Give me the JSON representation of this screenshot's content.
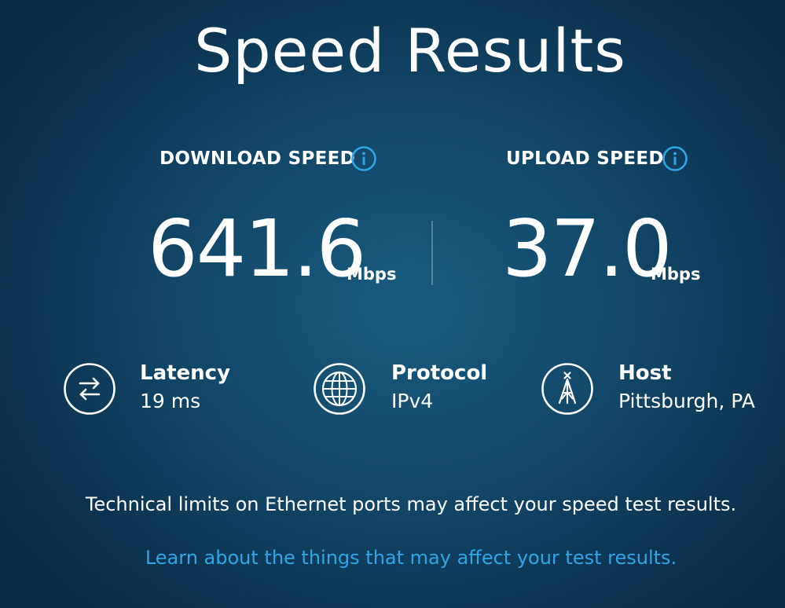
{
  "title": "Speed Results",
  "download": {
    "label": "DOWNLOAD SPEED",
    "value": "641.6",
    "unit": "Mbps",
    "info_icon": "info-circle-icon"
  },
  "upload": {
    "label": "UPLOAD SPEED",
    "value": "37.0",
    "unit": "Mbps",
    "info_icon": "info-circle-icon"
  },
  "stats": {
    "latency": {
      "label": "Latency",
      "value": "19 ms",
      "icon": "swap-arrows-icon"
    },
    "protocol": {
      "label": "Protocol",
      "value": "IPv4",
      "icon": "globe-icon"
    },
    "host": {
      "label": "Host",
      "value": "Pittsburgh, PA",
      "icon": "cell-tower-icon"
    }
  },
  "notice": "Technical limits on Ethernet ports may affect your speed test results.",
  "learn_link": "Learn about the things that may affect your test results.",
  "colors": {
    "accent": "#2fa5e8",
    "background_center": "#185b7f",
    "background_edge": "#0a2c47",
    "text": "#ffffff"
  }
}
